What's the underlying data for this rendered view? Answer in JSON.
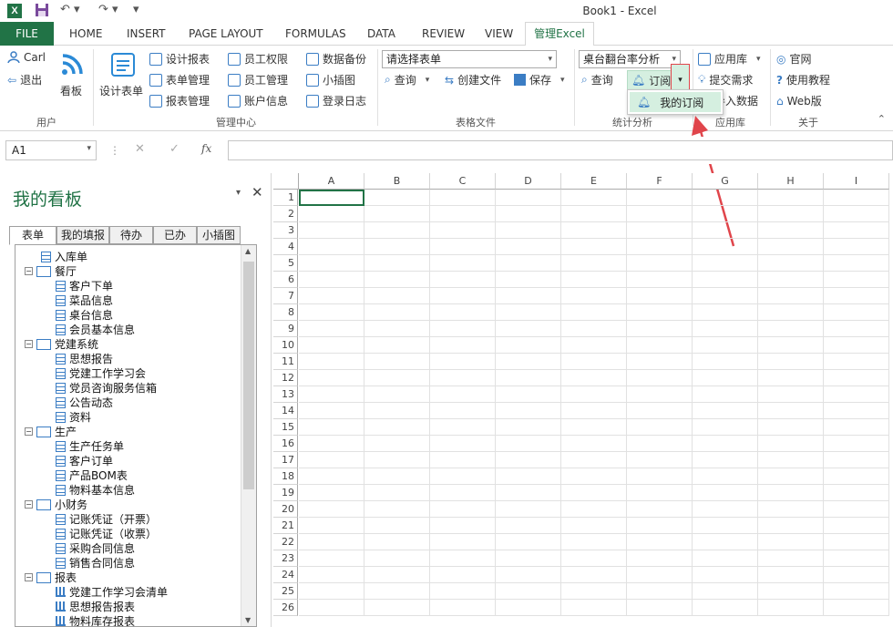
{
  "window": {
    "title": "Book1 - Excel",
    "logo": "X"
  },
  "tabs": {
    "file": "FILE",
    "items": [
      "HOME",
      "INSERT",
      "PAGE LAYOUT",
      "FORMULAS",
      "DATA",
      "REVIEW",
      "VIEW"
    ],
    "active": "管理Excel"
  },
  "ribbon": {
    "user": {
      "name": "Carl",
      "logout": "退出",
      "board": "看板",
      "group": "用户"
    },
    "mgmt": {
      "design_table": "设计表单",
      "design_report": "设计报表",
      "table_mgmt": "表单管理",
      "report_mgmt": "报表管理",
      "emp_perm": "员工权限",
      "emp_mgmt": "员工管理",
      "account_info": "账户信息",
      "data_backup": "数据备份",
      "small_chart": "小插图",
      "login_log": "登录日志",
      "group": "管理中心"
    },
    "file": {
      "select_placeholder": "请选择表单",
      "query": "查询",
      "create_file": "创建文件",
      "save": "保存",
      "group": "表格文件"
    },
    "stats": {
      "select_value": "桌台翻台率分析",
      "query": "查询",
      "subscribe": "订阅",
      "group": "统计分析"
    },
    "applib": {
      "app_store": "应用库",
      "submit_req": "提交需求",
      "import_data": "导入数据",
      "group": "应用库"
    },
    "about": {
      "official": "官网",
      "tutorial": "使用教程",
      "web": "Web版",
      "group": "关于"
    },
    "dropdown_item": "我的订阅"
  },
  "formula_bar": {
    "name_box": "A1",
    "fx": "fx"
  },
  "pane": {
    "title": "我的看板",
    "tabs": [
      "表单",
      "我的填报",
      "待办",
      "已办",
      "小插图"
    ],
    "tree": [
      {
        "label": "入库单",
        "level": 1,
        "kind": "doc"
      },
      {
        "label": "餐厅",
        "level": 0,
        "kind": "folder"
      },
      {
        "label": "客户下单",
        "level": 2,
        "kind": "doc"
      },
      {
        "label": "菜品信息",
        "level": 2,
        "kind": "doc"
      },
      {
        "label": "桌台信息",
        "level": 2,
        "kind": "doc"
      },
      {
        "label": "会员基本信息",
        "level": 2,
        "kind": "doc"
      },
      {
        "label": "党建系统",
        "level": 0,
        "kind": "folder"
      },
      {
        "label": "思想报告",
        "level": 2,
        "kind": "doc"
      },
      {
        "label": "党建工作学习会",
        "level": 2,
        "kind": "doc"
      },
      {
        "label": "党员咨询服务信箱",
        "level": 2,
        "kind": "doc"
      },
      {
        "label": "公告动态",
        "level": 2,
        "kind": "doc"
      },
      {
        "label": "资料",
        "level": 2,
        "kind": "doc"
      },
      {
        "label": "生产",
        "level": 0,
        "kind": "folder"
      },
      {
        "label": "生产任务单",
        "level": 2,
        "kind": "doc"
      },
      {
        "label": "客户订单",
        "level": 2,
        "kind": "doc"
      },
      {
        "label": "产品BOM表",
        "level": 2,
        "kind": "doc"
      },
      {
        "label": "物料基本信息",
        "level": 2,
        "kind": "doc"
      },
      {
        "label": "小财务",
        "level": 0,
        "kind": "folder"
      },
      {
        "label": "记账凭证（开票）",
        "level": 2,
        "kind": "doc"
      },
      {
        "label": "记账凭证（收票）",
        "level": 2,
        "kind": "doc"
      },
      {
        "label": "采购合同信息",
        "level": 2,
        "kind": "doc"
      },
      {
        "label": "销售合同信息",
        "level": 2,
        "kind": "doc"
      },
      {
        "label": "报表",
        "level": 0,
        "kind": "folder"
      },
      {
        "label": "党建工作学习会清单",
        "level": 2,
        "kind": "chart"
      },
      {
        "label": "思想报告报表",
        "level": 2,
        "kind": "chart"
      },
      {
        "label": "物料库存报表",
        "level": 2,
        "kind": "chart"
      }
    ]
  },
  "sheet": {
    "columns": [
      "A",
      "B",
      "C",
      "D",
      "E",
      "F",
      "G",
      "H",
      "I"
    ],
    "rows": [
      "1",
      "2",
      "3",
      "4",
      "5",
      "6",
      "7",
      "8",
      "9",
      "10",
      "11",
      "12",
      "13",
      "14",
      "15",
      "16",
      "17",
      "18",
      "19",
      "20",
      "21",
      "22",
      "23",
      "24",
      "25",
      "26"
    ]
  }
}
